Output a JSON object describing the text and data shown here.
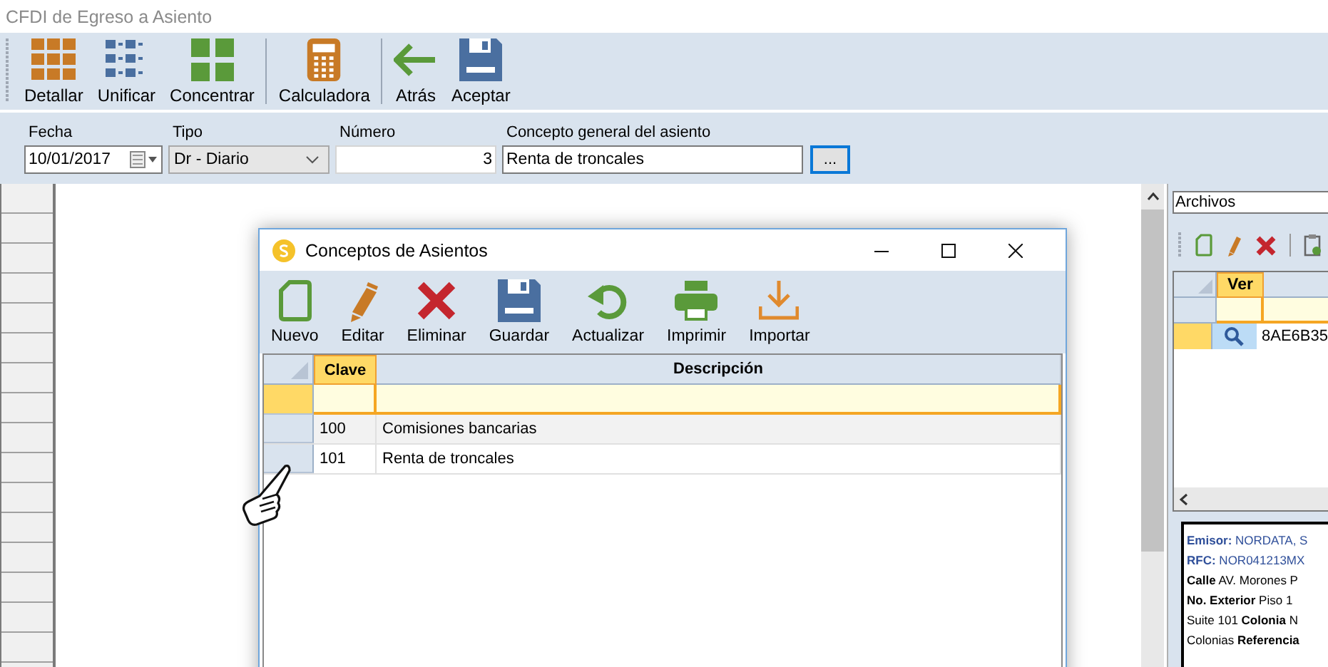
{
  "window": {
    "title": "CFDI de Egreso a Asiento"
  },
  "toolbar": [
    [
      {
        "kind": "tiles",
        "label": "Detallar"
      },
      {
        "kind": "list",
        "label": "Unificar"
      },
      {
        "kind": "blocks",
        "label": "Concentrar"
      }
    ],
    [
      {
        "kind": "calculator",
        "label": "Calculadora"
      }
    ],
    [
      {
        "kind": "back",
        "label": "Atrás"
      },
      {
        "kind": "save",
        "label": "Aceptar"
      }
    ]
  ],
  "form": {
    "fecha": {
      "label": "Fecha",
      "value": "10/01/2017"
    },
    "tipo": {
      "label": "Tipo",
      "value": "Dr - Diario"
    },
    "numero": {
      "label": "Número",
      "value": "3"
    },
    "concepto": {
      "label": "Concepto general del asiento",
      "value": "Renta de troncales"
    },
    "browse_button": "..."
  },
  "right_panel": {
    "dropdown": "Archivos",
    "grid": {
      "columns": [
        {
          "label": "Ver",
          "selected": true
        }
      ],
      "rows": [
        {
          "value": "8AE6B35",
          "selected": true
        }
      ]
    },
    "details": [
      {
        "kind": "party",
        "text": "**Emisor:** NORDATA, S"
      },
      {
        "kind": "party",
        "text": "**RFC:** NOR041213MX"
      },
      {
        "kind": "address",
        "text": "**Calle** AV. Morones P"
      },
      {
        "kind": "address",
        "text": "**No. Exterior** Piso 1"
      },
      {
        "kind": "address",
        "text": "Suite 101 **Colonia** N"
      },
      {
        "kind": "address",
        "text": "Colonias **Referencia**"
      }
    ]
  },
  "dialog": {
    "title": "Conceptos de Asientos",
    "toolbar": [
      {
        "kind": "new",
        "label": "Nuevo"
      },
      {
        "kind": "edit",
        "label": "Editar"
      },
      {
        "kind": "delete",
        "label": "Eliminar"
      },
      {
        "kind": "save",
        "label": "Guardar"
      },
      {
        "kind": "refresh",
        "label": "Actualizar"
      },
      {
        "kind": "print",
        "label": "Imprimir"
      },
      {
        "kind": "import",
        "label": "Importar"
      }
    ],
    "table": {
      "columns": [
        {
          "label": "Clave",
          "selected": true
        },
        {
          "label": "Descripción",
          "selected": false
        }
      ],
      "rows": [
        {
          "clave": "100",
          "descripcion": "Comisiones bancarias",
          "selected": false
        },
        {
          "clave": "101",
          "descripcion": "Renta de troncales",
          "selected": false
        }
      ]
    }
  }
}
